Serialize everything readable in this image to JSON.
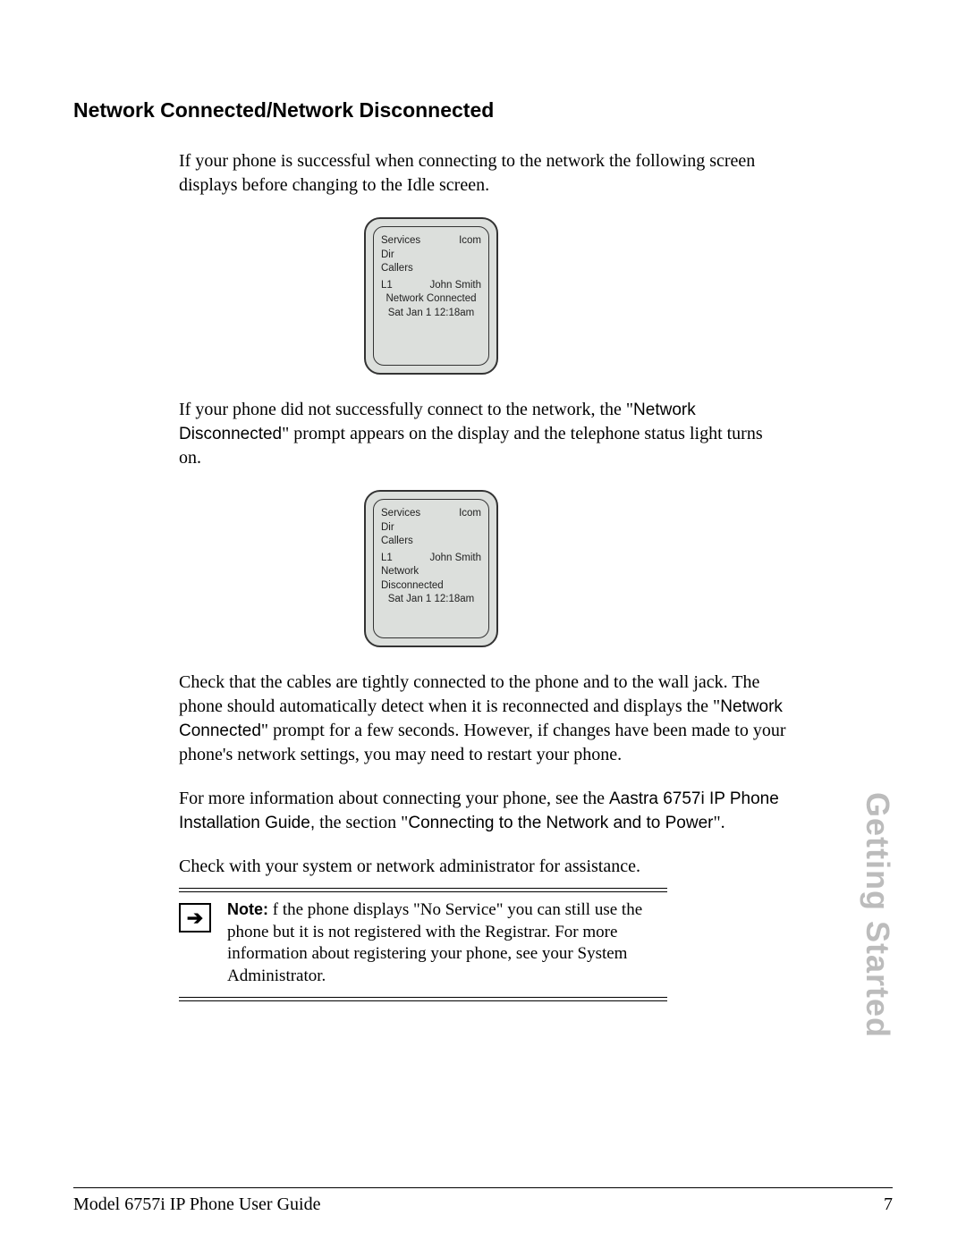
{
  "heading": "Network Connected/Network Disconnected",
  "para1": "If your phone is successful when connecting to the network the following screen displays before changing to the Idle screen.",
  "phone1": {
    "row1_left": "Services",
    "row1_right": "Icom",
    "row2": "Dir",
    "row3": "Callers",
    "row4_left": "L1",
    "row4_right": "John Smith",
    "status": "Network Connected",
    "datetime": "Sat  Jan 1  12:18am"
  },
  "para2_a": "If your phone did not successfully connect to the network, the \"",
  "para2_sans": "Network Disconnected",
  "para2_b": "\" prompt appears on the display and the telephone status light turns on.",
  "phone2": {
    "row1_left": "Services",
    "row1_right": "Icom",
    "row2": "Dir",
    "row3": "Callers",
    "row4_left": "L1",
    "row4_right": "John Smith",
    "status": "Network Disconnected",
    "datetime": "Sat  Jan 1  12:18am"
  },
  "para3_a": "Check that the cables are tightly connected to the phone and to the wall jack. The phone should automatically detect when it is reconnected and displays the \"",
  "para3_sans": "Network Connected",
  "para3_b": "\" prompt for a few seconds. However, if changes have been made to your phone's network settings, you may need to restart your phone.",
  "para4_a": "For more information about connecting your phone, see the ",
  "para4_sans1": "Aastra 6757i IP Phone Installation Guide,",
  "para4_b": " the section \"",
  "para4_sans2": "Connecting to the Network and to Power",
  "para4_c": "\".",
  "para5": "Check with your system or network administrator for assistance.",
  "note_label": "Note:",
  "note_body": " f the phone displays \"No Service\" you can still use the phone but it is not registered with the Registrar. For more information about registering your phone, see your System Administrator.",
  "side_tab": "Getting Started",
  "footer_left": "Model 6757i IP Phone User Guide",
  "footer_right": "7"
}
